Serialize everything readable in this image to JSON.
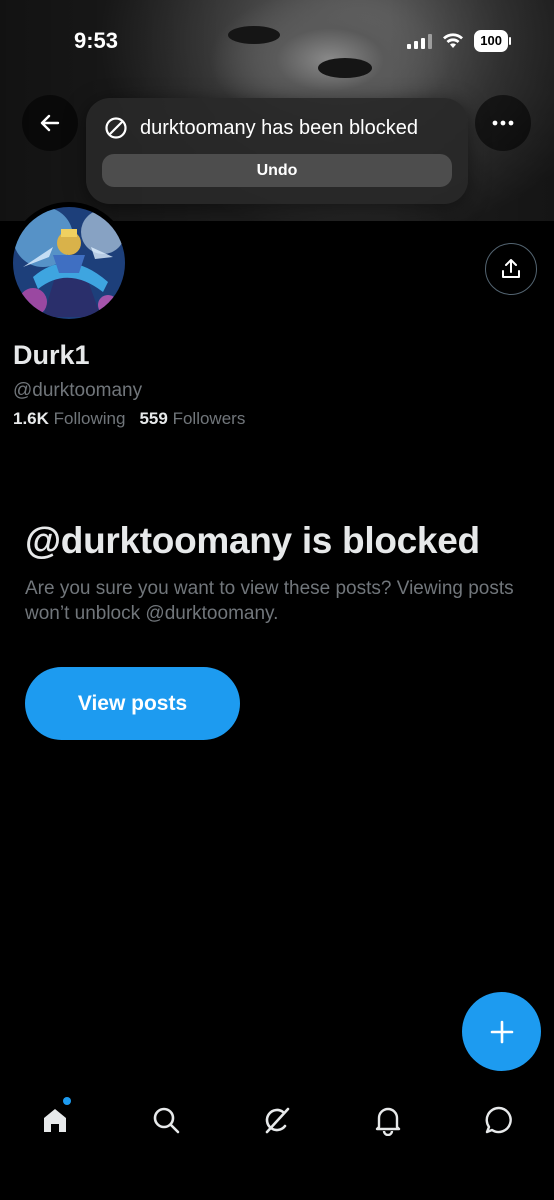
{
  "status_bar": {
    "time": "9:53",
    "battery": "100"
  },
  "toast": {
    "message": "durktoomany has been blocked",
    "undo_label": "Undo"
  },
  "profile": {
    "name": "Durk1",
    "handle": "@durktoomany",
    "following_count": "1.6K",
    "following_label": "Following",
    "followers_count": "559",
    "followers_label": "Followers"
  },
  "blocked": {
    "title": "@durktoomany is blocked",
    "description": "Are you sure you want to view these posts? Viewing posts won’t unblock @durktoomany.",
    "view_posts_label": "View posts"
  },
  "tabbar": {
    "items": [
      "home-icon",
      "search-icon",
      "grok-icon",
      "notifications-icon",
      "messages-icon"
    ],
    "active": "home-icon"
  },
  "colors": {
    "accent": "#1d9bf0",
    "background": "#000000",
    "secondary_text": "#71767b"
  }
}
